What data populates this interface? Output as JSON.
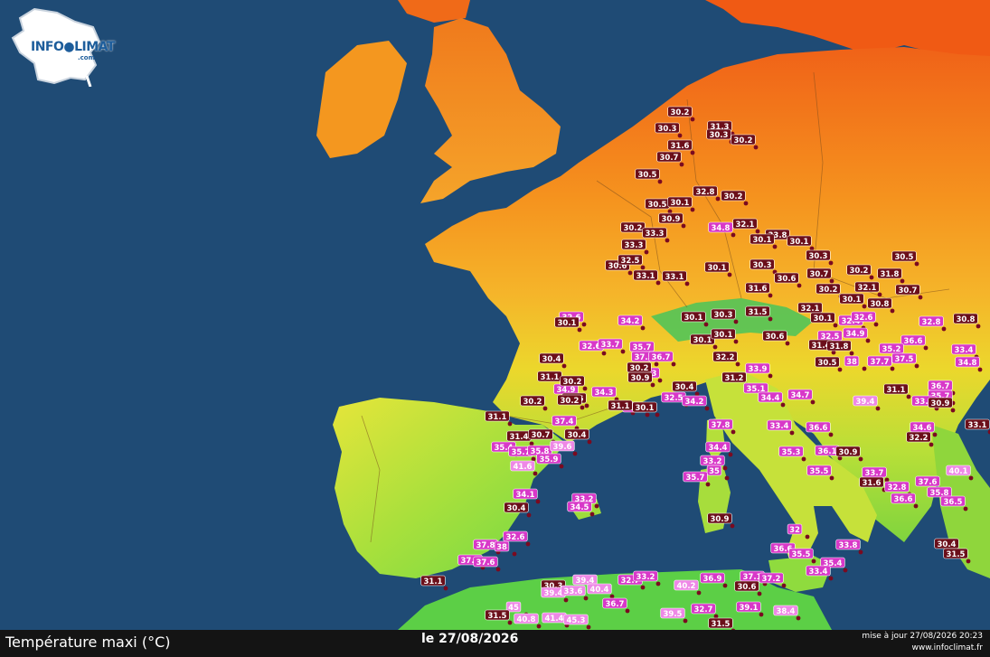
{
  "brand": {
    "name_left": "INFO",
    "name_right": "LIMAT",
    "suffix": ".com"
  },
  "footer": {
    "title": "Température maxi (°C)",
    "date": "le 27/08/2026",
    "update": "mise à jour 27/08/2026 20:23",
    "site": "www.infoclimat.fr"
  },
  "colors": {
    "sea": "#1f4b75",
    "hot": "#f07a1a",
    "warm": "#f5a623",
    "mild": "#f2d52a",
    "cool": "#8fdc3c",
    "fresh": "#3fc85c",
    "label_dark": "#6b0f1a",
    "label_pink": "#d838c8",
    "label_lightpink": "#ee88e6"
  },
  "stations": [
    {
      "v": "30.2",
      "c": "dark"
    },
    {
      "v": "31.3",
      "c": "dark"
    },
    {
      "v": "30.3",
      "c": "dark"
    },
    {
      "v": "30.3",
      "c": "dark"
    },
    {
      "v": "30.2",
      "c": "dark"
    },
    {
      "v": "31.6",
      "c": "dark"
    },
    {
      "v": "30.7",
      "c": "dark"
    },
    {
      "v": "30.5",
      "c": "dark"
    },
    {
      "v": "32.8",
      "c": "dark"
    },
    {
      "v": "30.2",
      "c": "dark"
    },
    {
      "v": "30.5",
      "c": "dark"
    },
    {
      "v": "30.1",
      "c": "dark"
    },
    {
      "v": "30.9",
      "c": "dark"
    },
    {
      "v": "32.1",
      "c": "dark"
    },
    {
      "v": "34.8",
      "c": "pink"
    },
    {
      "v": "30.2",
      "c": "dark"
    },
    {
      "v": "33.3",
      "c": "dark"
    },
    {
      "v": "33.8",
      "c": "dark"
    },
    {
      "v": "30.1",
      "c": "dark"
    },
    {
      "v": "30.1",
      "c": "dark"
    },
    {
      "v": "33.3",
      "c": "dark"
    },
    {
      "v": "30.6",
      "c": "dark"
    },
    {
      "v": "30.3",
      "c": "dark"
    },
    {
      "v": "32.5",
      "c": "dark"
    },
    {
      "v": "30.1",
      "c": "dark"
    },
    {
      "v": "33.1",
      "c": "dark"
    },
    {
      "v": "30.3",
      "c": "dark"
    },
    {
      "v": "33.1",
      "c": "dark"
    },
    {
      "v": "31.6",
      "c": "dark"
    },
    {
      "v": "30.6",
      "c": "dark"
    },
    {
      "v": "30.7",
      "c": "dark"
    },
    {
      "v": "30.2",
      "c": "dark"
    },
    {
      "v": "31.8",
      "c": "dark"
    },
    {
      "v": "30.5",
      "c": "dark"
    },
    {
      "v": "30.7",
      "c": "dark"
    },
    {
      "v": "32.1",
      "c": "dark"
    },
    {
      "v": "30.2",
      "c": "dark"
    },
    {
      "v": "30.1",
      "c": "dark"
    },
    {
      "v": "32.6",
      "c": "pink"
    },
    {
      "v": "30.1",
      "c": "dark"
    },
    {
      "v": "32.6",
      "c": "pink"
    },
    {
      "v": "34.2",
      "c": "pink"
    },
    {
      "v": "30.1",
      "c": "dark"
    },
    {
      "v": "30.3",
      "c": "dark"
    },
    {
      "v": "31.5",
      "c": "dark"
    },
    {
      "v": "32.1",
      "c": "dark"
    },
    {
      "v": "30.8",
      "c": "dark"
    },
    {
      "v": "30.1",
      "c": "dark"
    },
    {
      "v": "32.4",
      "c": "pink"
    },
    {
      "v": "32.8",
      "c": "pink"
    },
    {
      "v": "30.8",
      "c": "dark"
    },
    {
      "v": "32.6",
      "c": "pink"
    },
    {
      "v": "33.7",
      "c": "pink"
    },
    {
      "v": "35.7",
      "c": "pink"
    },
    {
      "v": "37.5",
      "c": "pink"
    },
    {
      "v": "36.7",
      "c": "pink"
    },
    {
      "v": "30.1",
      "c": "dark"
    },
    {
      "v": "30.1",
      "c": "dark"
    },
    {
      "v": "30.6",
      "c": "dark"
    },
    {
      "v": "32.5",
      "c": "pink"
    },
    {
      "v": "34.9",
      "c": "pink"
    },
    {
      "v": "31.4",
      "c": "dark"
    },
    {
      "v": "31.8",
      "c": "dark"
    },
    {
      "v": "34.3",
      "c": "pink"
    },
    {
      "v": "36.6",
      "c": "pink"
    },
    {
      "v": "35.2",
      "c": "pink"
    },
    {
      "v": "37.7",
      "c": "pink"
    },
    {
      "v": "37.5",
      "c": "pink"
    },
    {
      "v": "33.4",
      "c": "pink"
    },
    {
      "v": "34.8",
      "c": "pink"
    },
    {
      "v": "30.4",
      "c": "dark"
    },
    {
      "v": "30.2",
      "c": "dark"
    },
    {
      "v": "30.9",
      "c": "dark"
    },
    {
      "v": "32.2",
      "c": "dark"
    },
    {
      "v": "33.9",
      "c": "pink"
    },
    {
      "v": "30.4",
      "c": "dark"
    },
    {
      "v": "31.2",
      "c": "dark"
    },
    {
      "v": "35.1",
      "c": "pink"
    },
    {
      "v": "38",
      "c": "pink"
    },
    {
      "v": "30.5",
      "c": "dark"
    },
    {
      "v": "31.1",
      "c": "dark"
    },
    {
      "v": "36.7",
      "c": "pink"
    },
    {
      "v": "35.7",
      "c": "pink"
    },
    {
      "v": "31.1",
      "c": "dark"
    },
    {
      "v": "34.9",
      "c": "pink"
    },
    {
      "v": "30.2",
      "c": "dark"
    },
    {
      "v": "30.6",
      "c": "dark"
    },
    {
      "v": "34.3",
      "c": "pink"
    },
    {
      "v": "32.5",
      "c": "pink"
    },
    {
      "v": "34.2",
      "c": "pink"
    },
    {
      "v": "34.4",
      "c": "pink"
    },
    {
      "v": "34.7",
      "c": "pink"
    },
    {
      "v": "39.4",
      "c": "lightpink"
    },
    {
      "v": "33.8",
      "c": "pink"
    },
    {
      "v": "30.9",
      "c": "dark"
    },
    {
      "v": "30.2",
      "c": "dark"
    },
    {
      "v": "35.7",
      "c": "pink"
    },
    {
      "v": "30.1",
      "c": "dark"
    },
    {
      "v": "31.1",
      "c": "dark"
    },
    {
      "v": "30.2",
      "c": "dark"
    },
    {
      "v": "37.4",
      "c": "pink"
    },
    {
      "v": "30.4",
      "c": "dark"
    },
    {
      "v": "31.1",
      "c": "dark"
    },
    {
      "v": "31.4",
      "c": "dark"
    },
    {
      "v": "30.7",
      "c": "dark"
    },
    {
      "v": "37.8",
      "c": "pink"
    },
    {
      "v": "33.4",
      "c": "pink"
    },
    {
      "v": "36.6",
      "c": "pink"
    },
    {
      "v": "34.6",
      "c": "pink"
    },
    {
      "v": "33.1",
      "c": "dark"
    },
    {
      "v": "35.4",
      "c": "pink"
    },
    {
      "v": "35.7",
      "c": "pink"
    },
    {
      "v": "35.8",
      "c": "pink"
    },
    {
      "v": "39.6",
      "c": "lightpink"
    },
    {
      "v": "34.4",
      "c": "pink"
    },
    {
      "v": "35.3",
      "c": "pink"
    },
    {
      "v": "36.1",
      "c": "pink"
    },
    {
      "v": "30.9",
      "c": "dark"
    },
    {
      "v": "32.2",
      "c": "dark"
    },
    {
      "v": "35.9",
      "c": "pink"
    },
    {
      "v": "41.6",
      "c": "lightpink"
    },
    {
      "v": "33.2",
      "c": "pink"
    },
    {
      "v": "35",
      "c": "pink"
    },
    {
      "v": "35.5",
      "c": "pink"
    },
    {
      "v": "33.7",
      "c": "pink"
    },
    {
      "v": "31.6",
      "c": "dark"
    },
    {
      "v": "40.1",
      "c": "lightpink"
    },
    {
      "v": "35.7",
      "c": "pink"
    },
    {
      "v": "32.8",
      "c": "pink"
    },
    {
      "v": "37.6",
      "c": "pink"
    },
    {
      "v": "35.8",
      "c": "pink"
    },
    {
      "v": "34.1",
      "c": "pink"
    },
    {
      "v": "33.2",
      "c": "pink"
    },
    {
      "v": "36.6",
      "c": "pink"
    },
    {
      "v": "36.5",
      "c": "pink"
    },
    {
      "v": "30.4",
      "c": "dark"
    },
    {
      "v": "34.5",
      "c": "pink"
    },
    {
      "v": "30.9",
      "c": "dark"
    },
    {
      "v": "32.6",
      "c": "pink"
    },
    {
      "v": "32",
      "c": "pink"
    },
    {
      "v": "37.8",
      "c": "pink"
    },
    {
      "v": "38",
      "c": "pink"
    },
    {
      "v": "36.6",
      "c": "pink"
    },
    {
      "v": "35.5",
      "c": "pink"
    },
    {
      "v": "33.8",
      "c": "pink"
    },
    {
      "v": "30.4",
      "c": "dark"
    },
    {
      "v": "37.5",
      "c": "pink"
    },
    {
      "v": "37.6",
      "c": "pink"
    },
    {
      "v": "35.4",
      "c": "pink"
    },
    {
      "v": "31.5",
      "c": "dark"
    },
    {
      "v": "33.4",
      "c": "pink"
    },
    {
      "v": "31.1",
      "c": "dark"
    },
    {
      "v": "30.3",
      "c": "dark"
    },
    {
      "v": "39.4",
      "c": "lightpink"
    },
    {
      "v": "32.7",
      "c": "pink"
    },
    {
      "v": "33.2",
      "c": "pink"
    },
    {
      "v": "37.1",
      "c": "pink"
    },
    {
      "v": "37.2",
      "c": "pink"
    },
    {
      "v": "39.4",
      "c": "lightpink"
    },
    {
      "v": "33.6",
      "c": "lightpink"
    },
    {
      "v": "40.4",
      "c": "lightpink"
    },
    {
      "v": "40.2",
      "c": "lightpink"
    },
    {
      "v": "36.9",
      "c": "pink"
    },
    {
      "v": "30.6",
      "c": "dark"
    },
    {
      "v": "45",
      "c": "lightpink"
    },
    {
      "v": "36.7",
      "c": "pink"
    },
    {
      "v": "39.1",
      "c": "pink"
    },
    {
      "v": "39.5",
      "c": "lightpink"
    },
    {
      "v": "32.7",
      "c": "pink"
    },
    {
      "v": "38.4",
      "c": "lightpink"
    },
    {
      "v": "31.5",
      "c": "dark"
    },
    {
      "v": "40.8",
      "c": "lightpink"
    },
    {
      "v": "41.4",
      "c": "lightpink"
    },
    {
      "v": "45.3",
      "c": "lightpink"
    },
    {
      "v": "31.5",
      "c": "dark"
    }
  ]
}
